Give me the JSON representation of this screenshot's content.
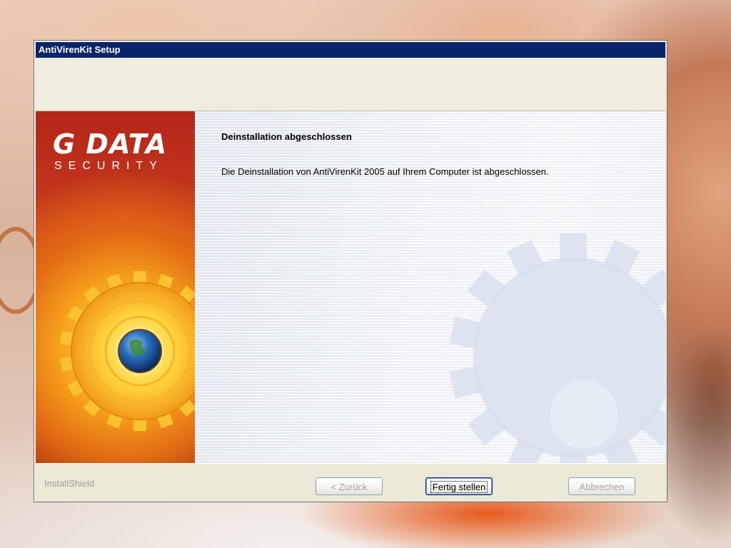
{
  "window": {
    "title": "AntiVirenKit Setup"
  },
  "banner": {
    "logo_main": "G DATA",
    "logo_sub": "SECURITY"
  },
  "content": {
    "heading": "Deinstallation abgeschlossen",
    "message": "Die Deinstallation von AntiVirenKit 2005 auf Ihrem Computer ist abgeschlossen."
  },
  "footer": {
    "brand": "InstallShield",
    "back_label": "< Zurück",
    "finish_label": "Fertig stellen",
    "cancel_label": "Abbrechen"
  },
  "colors": {
    "titlebar": "#0a246a",
    "dialog_face": "#ece9d8",
    "banner_red": "#b4261a",
    "gear_yellow": "#ffcf3a"
  },
  "icons": [
    "gear-globe-icon",
    "watermark-gear-icon"
  ]
}
